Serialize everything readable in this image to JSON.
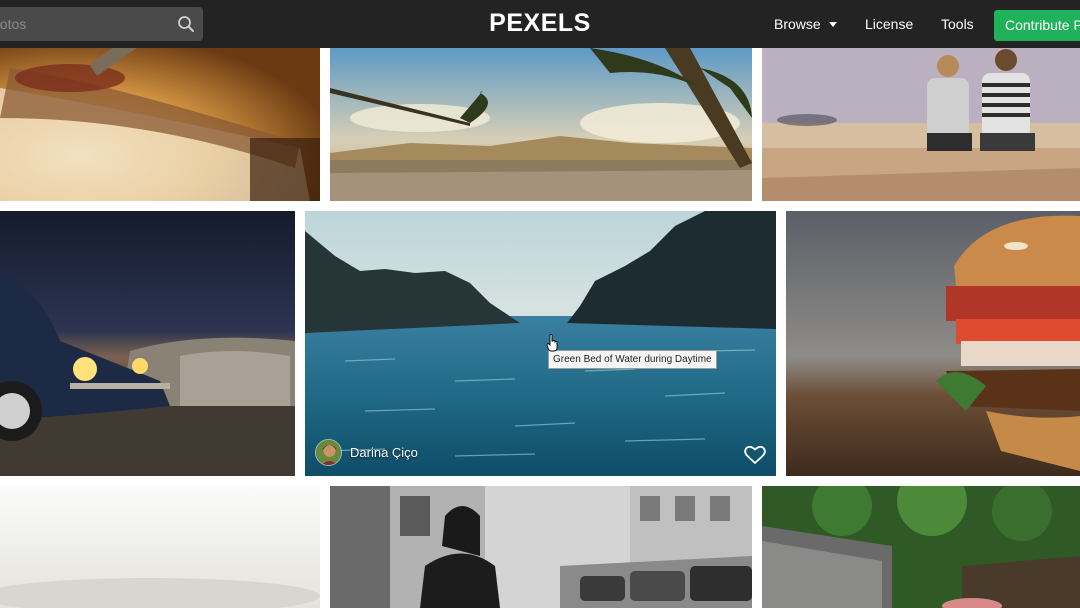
{
  "header": {
    "search_placeholder": "hotos",
    "logo": "PEXELS",
    "nav": {
      "browse": "Browse",
      "license": "License",
      "tools": "Tools",
      "contribute": "Contribute P"
    }
  },
  "hovered_photo": {
    "tooltip": "Green Bed of Water during Daytime",
    "photographer": "Darina Çiço"
  },
  "icons": {
    "search": "search-icon",
    "caret": "chevron-down-icon",
    "like": "heart-icon",
    "cursor": "hand-pointer-icon"
  },
  "colors": {
    "header_bg": "#232323",
    "contribute_bg": "#1fb25a",
    "search_bg": "#4a4a4a"
  }
}
